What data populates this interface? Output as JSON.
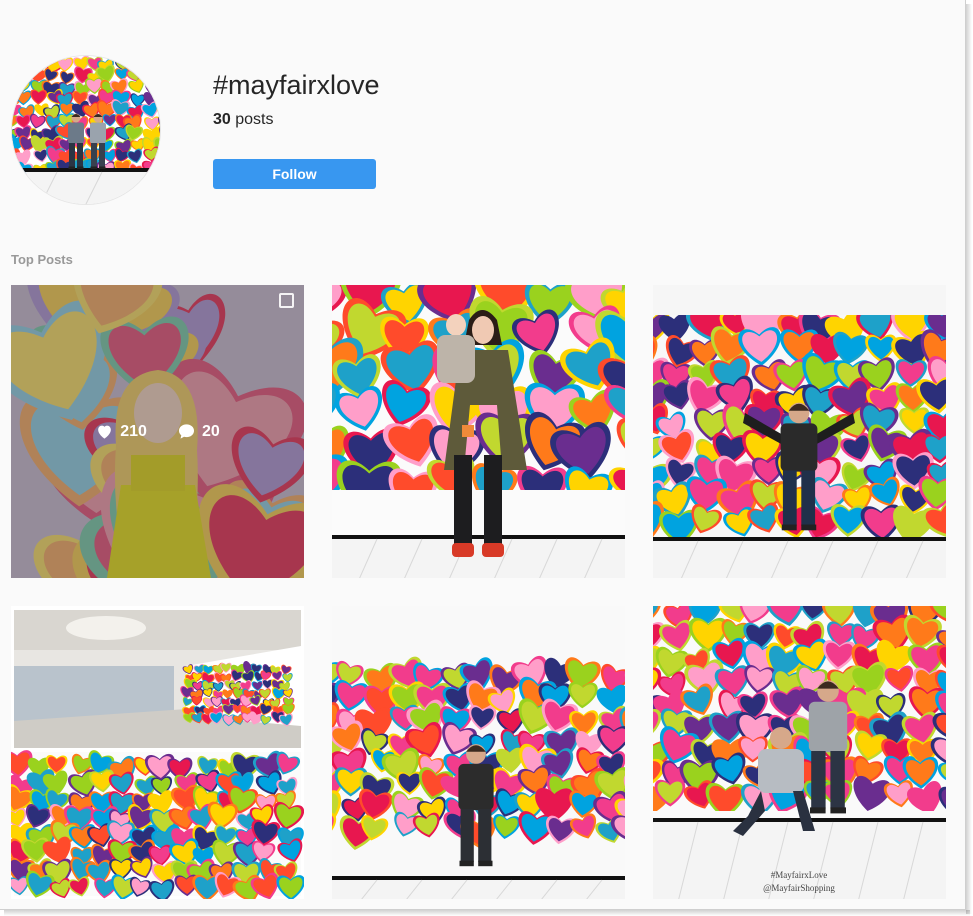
{
  "header": {
    "hashtag": "#mayfairxlove",
    "post_count": "30",
    "posts_label": " posts",
    "follow_label": "Follow"
  },
  "section": {
    "title": "Top Posts"
  },
  "colors": {
    "accent": "#3897f0",
    "heart_palette": [
      "#e8174f",
      "#f23c8c",
      "#ffd400",
      "#00a3e0",
      "#6a2d8f",
      "#ff7a1a",
      "#9ad21e",
      "#2c2f7a",
      "#ff4b2b",
      "#c1d82f",
      "#1ea1c9",
      "#ff9ec9"
    ]
  },
  "posts": [
    {
      "id": "post-1",
      "likes": "210",
      "comments": "20",
      "hovered": true,
      "multi": true,
      "scene": "woman-yellow-dress"
    },
    {
      "id": "post-2",
      "scene": "woman-with-child"
    },
    {
      "id": "post-3",
      "scene": "man-arms-out"
    },
    {
      "id": "post-4",
      "scene": "mall-mural-collage"
    },
    {
      "id": "post-5",
      "scene": "man-standing"
    },
    {
      "id": "post-6",
      "scene": "two-men-posing",
      "watermark": [
        "#MayfairxLove",
        "@MayfairShopping"
      ]
    }
  ]
}
